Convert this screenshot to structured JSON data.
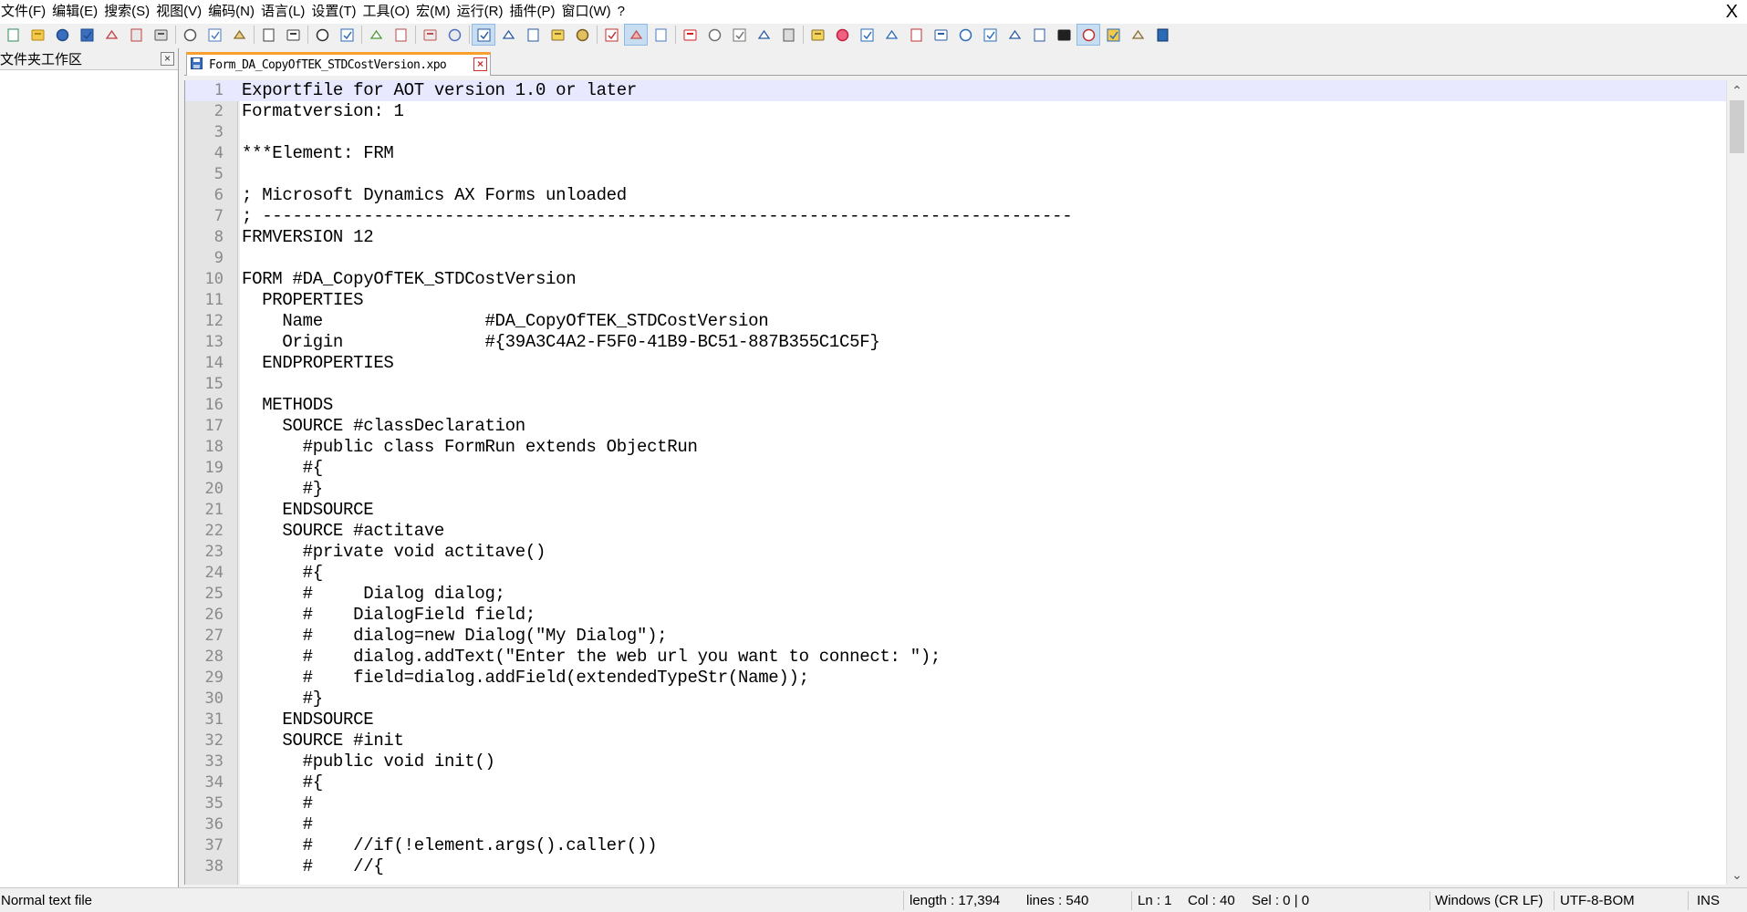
{
  "menus": [
    "文件(F)",
    "编辑(E)",
    "搜索(S)",
    "视图(V)",
    "编码(N)",
    "语言(L)",
    "设置(T)",
    "工具(O)",
    "宏(M)",
    "运行(R)",
    "插件(P)",
    "窗口(W)",
    "?"
  ],
  "window_close": "X",
  "toolbar_icons": [
    "new-file-icon",
    "open-file-icon",
    "save-icon",
    "save-all-icon",
    "close-icon",
    "close-all-icon",
    "print-icon",
    "cut-icon",
    "copy-icon",
    "paste-icon",
    "undo-icon",
    "redo-icon",
    "find-icon",
    "replace-icon",
    "zoom-in-icon",
    "zoom-out-icon",
    "sync-vertical-icon",
    "sync-horizontal-icon",
    "word-wrap-icon",
    "show-all-chars-icon",
    "indent-guide-icon",
    "language-icon",
    "doc-map-icon",
    "function-list-icon",
    "folder-workspace-icon",
    "monitoring-icon",
    "record-macro-icon",
    "stop-macro-icon",
    "play-macro-icon",
    "run-macro-multiple-icon",
    "save-macro-icon",
    "comment-icon",
    "favorite-icon",
    "insert-icon",
    "compare-icon",
    "compare-2-icon",
    "clear-icon",
    "up-arrow-icon",
    "down-arrow-icon",
    "last-icon",
    "first-icon",
    "console-icon",
    "spell-check-icon",
    "explorer-icon",
    "options-icon",
    "globe-icon"
  ],
  "left_panel": {
    "title": "文件夹工作区",
    "close": "×"
  },
  "tab": {
    "label": "Form_DA_CopyOfTEK_STDCostVersion.xpo",
    "close": "×"
  },
  "editor": {
    "current_line": 1,
    "lines": [
      "Exportfile for AOT version 1.0 or later",
      "Formatversion: 1",
      "",
      "***Element: FRM",
      "",
      "; Microsoft Dynamics AX Forms unloaded",
      "; --------------------------------------------------------------------------------",
      "FRMVERSION 12",
      "",
      "FORM #DA_CopyOfTEK_STDCostVersion",
      "  PROPERTIES",
      "    Name                #DA_CopyOfTEK_STDCostVersion",
      "    Origin              #{39A3C4A2-F5F0-41B9-BC51-887B355C1C5F}",
      "  ENDPROPERTIES",
      "",
      "  METHODS",
      "    SOURCE #classDeclaration",
      "      #public class FormRun extends ObjectRun",
      "      #{",
      "      #}",
      "    ENDSOURCE",
      "    SOURCE #actitave",
      "      #private void actitave()",
      "      #{",
      "      #     Dialog dialog;",
      "      #    DialogField field;",
      "      #    dialog=new Dialog(\"My Dialog\");",
      "      #    dialog.addText(\"Enter the web url you want to connect: \");",
      "      #    field=dialog.addField(extendedTypeStr(Name));",
      "      #}",
      "    ENDSOURCE",
      "    SOURCE #init",
      "      #public void init()",
      "      #{",
      "      #",
      "      #",
      "      #    //if(!element.args().caller())",
      "      #    //{"
    ]
  },
  "statusbar": {
    "file_type": "Normal text file",
    "length": "length : 17,394",
    "lines": "lines : 540",
    "ln": "Ln : 1",
    "col": "Col : 40",
    "sel": "Sel : 0 | 0",
    "eol": "Windows (CR LF)",
    "encoding": "UTF-8-BOM",
    "mode": "INS"
  }
}
